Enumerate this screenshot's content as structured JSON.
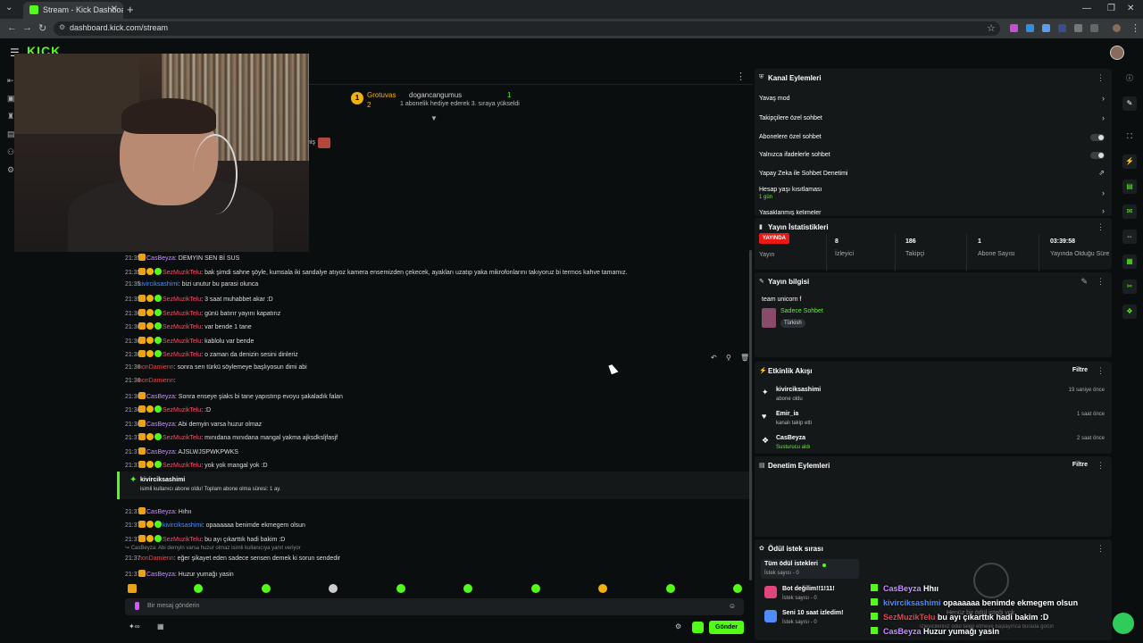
{
  "browser": {
    "tab_title": "Stream - Kick Dashboard",
    "url": "dashboard.kick.com/stream"
  },
  "header": {
    "logo": "KICK"
  },
  "pinned": {
    "user1": "Grotuvas",
    "user1_count": "2",
    "user2": "dogancangumus",
    "user2_count": "1",
    "description": "1 abonelik hediye ederek 3. sıraya yükseldi"
  },
  "donation_hint": "niş",
  "chat": {
    "messages": [
      {
        "time": "21:35",
        "user": "CasBeyza",
        "text": ": DEMYIN SEN Bİ SUS"
      },
      {
        "time": "21:35",
        "user": "SezMuzikTelu",
        "text": ": bak şimdi sahne şöyle, kumsala iki sandalye atıyoz kamera ensemizden çekecek, ayakları uzatıp yaka mikrofonlarını takıyoruz bi termos kahve tamamız."
      },
      {
        "time": "21:35",
        "user": "kivirciksashimi",
        "text": ": bizi unutur bu parasi olunca"
      },
      {
        "time": "21:35",
        "user": "SezMuzikTelu",
        "text": ": 3 saat muhabbet akar :D"
      },
      {
        "time": "21:36",
        "user": "SezMuzikTelu",
        "text": ": günü batırır yayını kapatırız"
      },
      {
        "time": "21:36",
        "user": "SezMuzikTelu",
        "text": ": var bende 1 tane"
      },
      {
        "time": "21:36",
        "user": "SezMuzikTelu",
        "text": ": kablolu var bende"
      },
      {
        "time": "21:36",
        "user": "SezMuzikTelu",
        "text": ": o zaman da denizin sesini dinleriz"
      },
      {
        "time": "21:36",
        "user": "nonDamienn",
        "text": ": sonra sen türkü söylemeye başlıyosun dimi abi"
      },
      {
        "time": "21:36",
        "user": "nonDamienn",
        "text": ":"
      },
      {
        "time": "21:36",
        "user": "CasBeyza",
        "text": ": Sonra enseye şiaks bi tane yapıstırıp evoyu şakaladık falan"
      },
      {
        "time": "21:36",
        "user": "SezMuzikTelu",
        "text": ": :D"
      },
      {
        "time": "21:36",
        "user": "CasBeyza",
        "text": ": Abi demyin varsa huzur olmaz"
      },
      {
        "time": "21:37",
        "user": "SezMuzikTelu",
        "text": ": mınıdana mınıdana mangal yakma ajksdksljfasjf"
      },
      {
        "time": "21:37",
        "user": "CasBeyza",
        "text": ": AJSLWJSPWKPWKS"
      },
      {
        "time": "21:37",
        "user": "SezMuzikTelu",
        "text": ": yok yok mangal yok :D"
      }
    ],
    "sub_event": {
      "user": "kivirciksashimi",
      "text": "isimli kullanıcı abone oldu! Toplam abone olma süresi: 1 ay."
    },
    "messages2": [
      {
        "time": "21:37",
        "user": "CasBeyza",
        "text": ": Hıhıı"
      },
      {
        "time": "21:37",
        "user": "kivirciksashimi",
        "text": ": opaaaaaa benimde ekmegem olsun"
      },
      {
        "time": "21:37",
        "user": "SezMuzikTelu",
        "text": ": bu ayı çıkarttık hadi bakim :D"
      }
    ],
    "reply_context": "↪ CasBeyza: Abi demyin varsa huzur olmaz isimli kullanıcıya yanıt veriyor",
    "messages3": [
      {
        "time": "21:37",
        "user": "nonDamienn",
        "text": ": eğer şikayet eden sadece sensen demek ki sorun sendedir"
      },
      {
        "time": "21:37",
        "user": "CasBeyza",
        "text": ": Huzur yumağı yasin"
      }
    ],
    "input_placeholder": "Bir mesaj gönderin",
    "send_label": "Gönder"
  },
  "channel_actions": {
    "title": "Kanal Eylemleri",
    "items": [
      {
        "label": "Yavaş mod"
      },
      {
        "label": "Takipçilere özel sohbet"
      },
      {
        "label": "Abonelere özel sohbet"
      },
      {
        "label": "Yalnızca ifadelerle sohbet"
      },
      {
        "label": "Yapay Zeka ile Sohbet Denetimi"
      },
      {
        "label": "Hesap yaşı kısıtlaması",
        "sub": "1 gün"
      },
      {
        "label": "Yasaklanmış kelimeler"
      }
    ]
  },
  "stats": {
    "title": "Yayın İstatistikleri",
    "live_badge": "YAYINDA",
    "live_label": "Yayın",
    "items": [
      {
        "value": "8",
        "label": "İzleyici"
      },
      {
        "value": "186",
        "label": "Takipçi"
      },
      {
        "value": "1",
        "label": "Abone Sayısı"
      },
      {
        "value": "03:39:58",
        "label": "Yayında Olduğu Süre"
      }
    ]
  },
  "stream_info": {
    "title": "Yayın bilgisi",
    "stream_title": "team unicorn f",
    "category": "Sadece Sohbet",
    "language": "Türkish"
  },
  "activity": {
    "title": "Etkinlik Akışı",
    "filter": "Filtre",
    "items": [
      {
        "name": "kivirciksashimi",
        "desc": "abone oldu",
        "time": "19 saniye önce"
      },
      {
        "name": "Emir_ia",
        "desc": "kanalı takip etti",
        "time": "1 saat önce"
      },
      {
        "name": "CasBeyza",
        "desc": "Susturucu aldı",
        "time": "2 saat önce"
      }
    ]
  },
  "moderation": {
    "title": "Denetim Eylemleri",
    "filter": "Filtre"
  },
  "rewards": {
    "title": "Ödül istek sırası",
    "items": [
      {
        "name": "Tüm ödül istekleri",
        "count": "İstek sayısı - 0"
      },
      {
        "name": "Bot değilim!!1!11!",
        "count": "İstek sayısı - 0"
      },
      {
        "name": "Seni 10 saat izledim!",
        "count": "İstek sayısı - 0"
      }
    ]
  },
  "overlay": {
    "lines": [
      {
        "user": "CasBeyza",
        "text": "Hhıı"
      },
      {
        "user": "kivirciksashimi",
        "text": "opaaaaaa benimde ekmegem olsun"
      },
      {
        "user": "SezMuzikTelu",
        "text": "bu ayı çıkarttık hadi bakim :D"
      },
      {
        "user": "CasBeyza",
        "text": "Huzur yumağı yasin"
      }
    ],
    "faded1": "Henüz bir ödül isteği yok",
    "faded2": "İzleyicileriniz ödül talep etmeye başlayınca burada görünecek edin!"
  },
  "colors": {
    "kick_green": "#53fc18",
    "live_red": "#e91916",
    "name_pink": "#f94f6a",
    "name_purple": "#c78fff",
    "name_blue": "#4f8dfd"
  }
}
